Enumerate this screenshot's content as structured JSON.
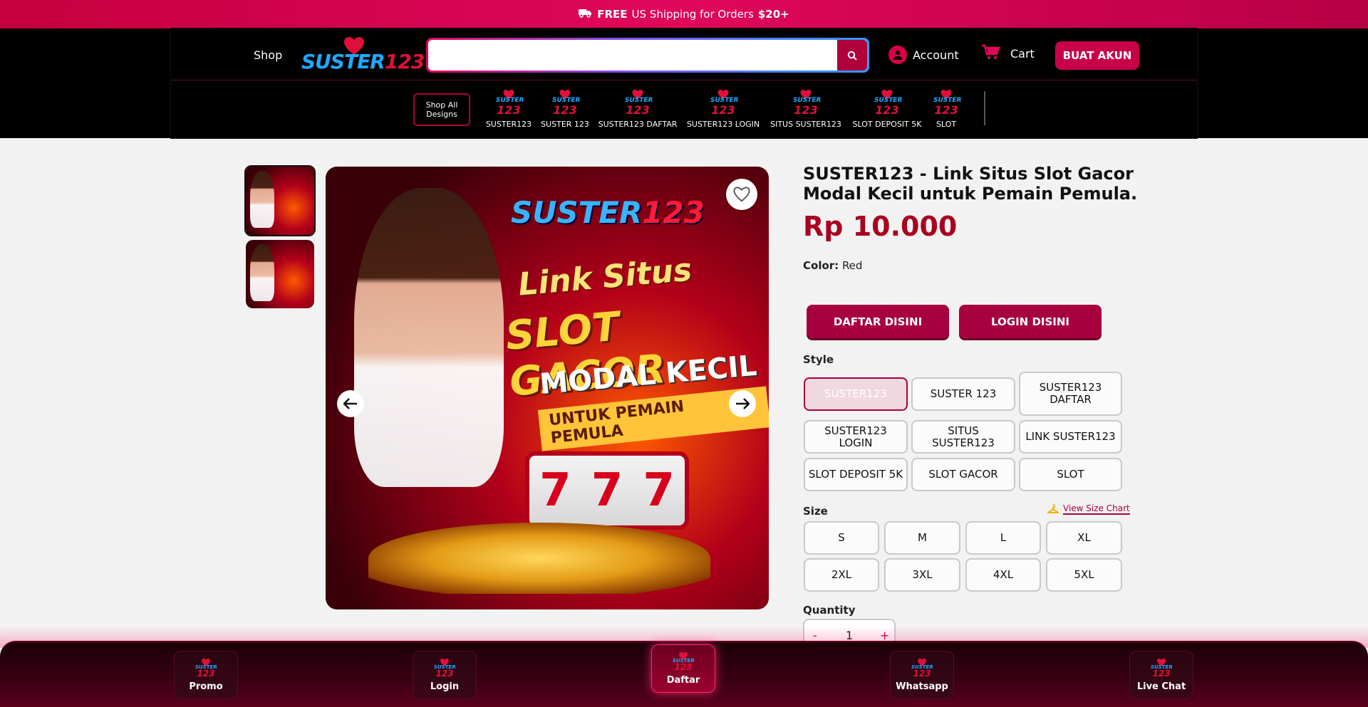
{
  "topbar": {
    "free": "FREE",
    "text": "US Shipping for Orders",
    "amount": "$20+"
  },
  "header": {
    "shop": "Shop",
    "logo_a": "SUSTER",
    "logo_b": "123",
    "search_placeholder": "",
    "account": "Account",
    "cart": "Cart",
    "create_account": "BUAT AKUN"
  },
  "categories": {
    "shop_all": "Shop All Designs",
    "items": [
      "SUSTER123",
      "SUSTER 123",
      "SUSTER123 DAFTAR",
      "SUSTER123 LOGIN",
      "SITUS SUSTER123",
      "SLOT DEPOSIT 5K",
      "SLOT"
    ]
  },
  "gallery": {
    "image_text": {
      "brand_a": "SUSTER",
      "brand_b": "123",
      "line1": "Link Situs",
      "line2": "SLOT GACOR",
      "line3": "MODAL KECIL",
      "line4": "UNTUK PEMAIN PEMULA",
      "reel": [
        "7",
        "7",
        "7"
      ]
    }
  },
  "product": {
    "title": "SUSTER123 - Link Situs Slot Gacor Modal Kecil untuk Pemain Pemula.",
    "price": "Rp 10.000",
    "color_label": "Color:",
    "color_value": "Red",
    "cta_register": "DAFTAR DISINI",
    "cta_login": "LOGIN DISINI",
    "style_label": "Style",
    "styles": [
      "SUSTER123",
      "SUSTER 123",
      "SUSTER123 DAFTAR",
      "SUSTER123 LOGIN",
      "SITUS SUSTER123",
      "LINK SUSTER123",
      "SLOT DEPOSIT 5K",
      "SLOT GACOR",
      "SLOT"
    ],
    "selected_style": "SUSTER123",
    "size_label": "Size",
    "size_chart": "View Size Chart",
    "sizes": [
      "S",
      "M",
      "L",
      "XL",
      "2XL",
      "3XL",
      "4XL",
      "5XL"
    ],
    "quantity_label": "Quantity",
    "qty_minus": "-",
    "qty_value": "1",
    "qty_plus": "+"
  },
  "bottom_nav": {
    "items": [
      "Promo",
      "Login",
      "Daftar",
      "Whatsapp",
      "Live Chat"
    ]
  },
  "colors": {
    "brand": "#c8004a",
    "price": "#a8001f",
    "header_bg": "#000000"
  }
}
